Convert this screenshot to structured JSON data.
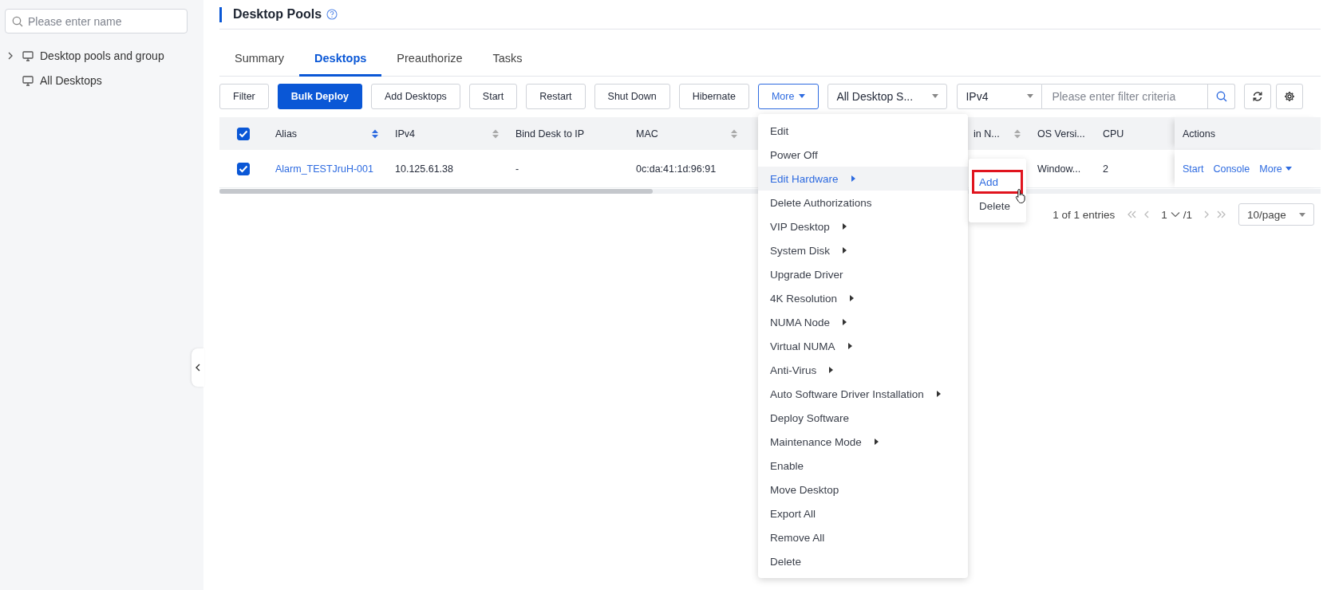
{
  "sidebar": {
    "search": {
      "placeholder": "Please enter name"
    },
    "tree": [
      {
        "label": "Desktop pools and group",
        "expanded": false
      },
      {
        "label": "All Desktops"
      }
    ]
  },
  "page": {
    "title": "Desktop Pools"
  },
  "tabs": [
    {
      "label": "Summary",
      "selected": false
    },
    {
      "label": "Desktops",
      "selected": true
    },
    {
      "label": "Preauthorize",
      "selected": false
    },
    {
      "label": "Tasks",
      "selected": false
    }
  ],
  "toolbar": {
    "buttons": [
      {
        "label": "Filter",
        "kind": "default"
      },
      {
        "label": "Bulk Deploy",
        "kind": "primary"
      },
      {
        "label": "Add Desktops",
        "kind": "default"
      },
      {
        "label": "Start",
        "kind": "default"
      },
      {
        "label": "Restart",
        "kind": "default"
      },
      {
        "label": "Shut Down",
        "kind": "default"
      },
      {
        "label": "Hibernate",
        "kind": "default"
      },
      {
        "label": "More",
        "kind": "dropdown",
        "open": true
      }
    ],
    "status_select": "All Desktop S...",
    "field_select": "IPv4",
    "search": {
      "placeholder": "Please enter filter criteria"
    }
  },
  "table": {
    "select_all": {
      "checked": true
    },
    "columns": [
      {
        "label": "Alias",
        "sorted": true
      },
      {
        "label": "IPv4",
        "sorted": false
      },
      {
        "label": "Bind Desk to IP"
      },
      {
        "label": "MAC",
        "sorted": false
      },
      {
        "label": "in N...",
        "sorted": false
      },
      {
        "label": "OS Versi..."
      },
      {
        "label": "CPU"
      },
      {
        "label": "Actions"
      }
    ],
    "rows": [
      {
        "selected": true,
        "alias": "Alarm_TESTJruH-001",
        "ipv4": "10.125.61.38",
        "bind_desk_to_ip": "-",
        "mac": "0c:da:41:1d:96:91",
        "os_version": "Window...",
        "cpu": "2",
        "actions": [
          "Start",
          "Console",
          "More"
        ]
      }
    ]
  },
  "pagination": {
    "summary": "1 of 1 entries",
    "page": "1",
    "total": "/1",
    "page_size": "10/page"
  },
  "more_menu": {
    "items": [
      {
        "label": "Edit",
        "submenu": false,
        "selected": false
      },
      {
        "label": "Power Off",
        "submenu": false,
        "selected": false
      },
      {
        "label": "Edit Hardware",
        "submenu": true,
        "selected": true
      },
      {
        "label": "Delete Authorizations",
        "submenu": false,
        "selected": false
      },
      {
        "label": "VIP Desktop",
        "submenu": true,
        "selected": false
      },
      {
        "label": "System Disk",
        "submenu": true,
        "selected": false
      },
      {
        "label": "Upgrade Driver",
        "submenu": false,
        "selected": false
      },
      {
        "label": "4K Resolution",
        "submenu": true,
        "selected": false
      },
      {
        "label": "NUMA Node",
        "submenu": true,
        "selected": false
      },
      {
        "label": "Virtual NUMA",
        "submenu": true,
        "selected": false
      },
      {
        "label": "Anti-Virus",
        "submenu": true,
        "selected": false
      },
      {
        "label": "Auto Software Driver Installation",
        "submenu": true,
        "selected": false
      },
      {
        "label": "Deploy Software",
        "submenu": false,
        "selected": false
      },
      {
        "label": "Maintenance Mode",
        "submenu": true,
        "selected": false
      },
      {
        "label": "Enable",
        "submenu": false,
        "selected": false
      },
      {
        "label": "Move Desktop",
        "submenu": false,
        "selected": false
      },
      {
        "label": "Export All",
        "submenu": false,
        "selected": false
      },
      {
        "label": "Remove All",
        "submenu": false,
        "selected": false
      },
      {
        "label": "Delete",
        "submenu": false,
        "selected": false
      }
    ]
  },
  "submenu": {
    "items": [
      {
        "label": "Add",
        "selected": true,
        "highlighted": true
      },
      {
        "label": "Delete",
        "selected": false,
        "highlighted": false
      }
    ]
  }
}
